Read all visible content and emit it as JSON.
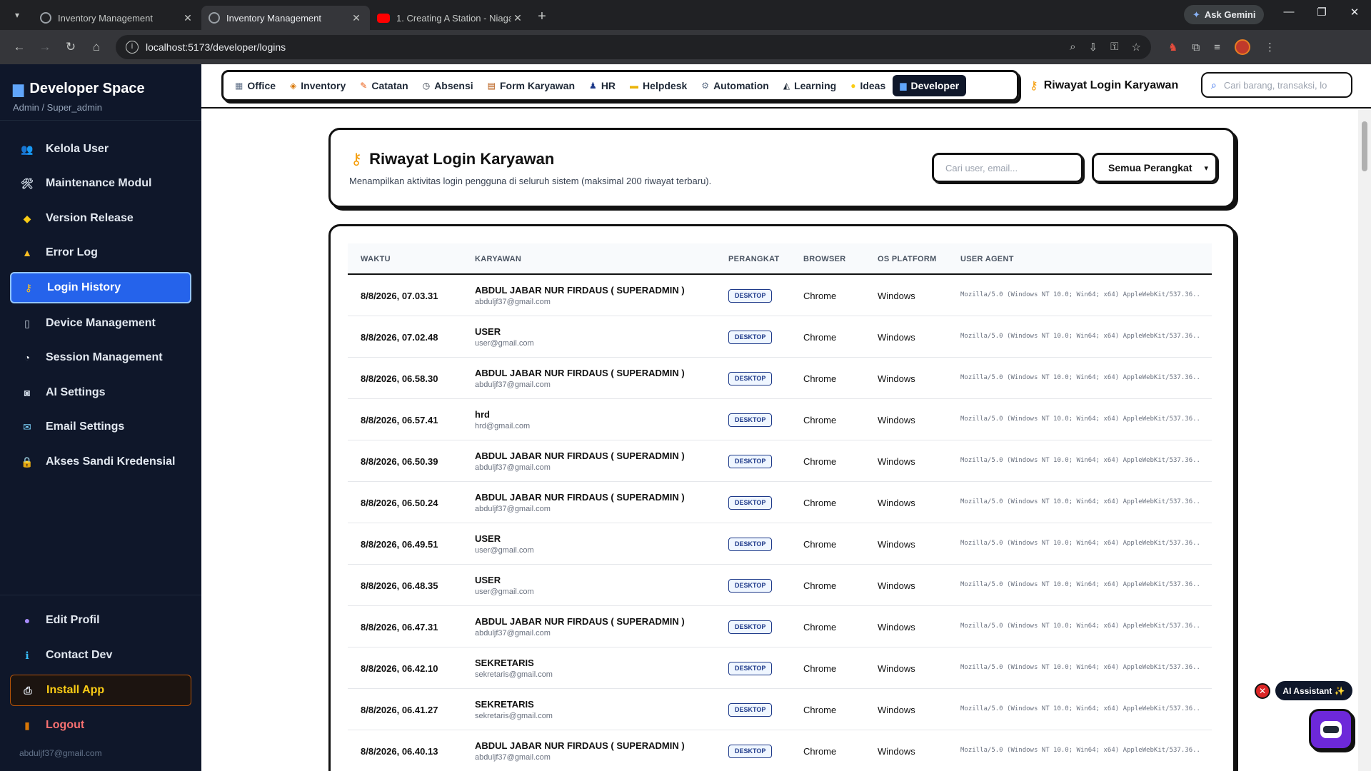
{
  "browser": {
    "tabs": [
      {
        "title": "Inventory Management",
        "active": false
      },
      {
        "title": "Inventory Management",
        "active": true
      },
      {
        "title": "1. Creating A Station - Niagara",
        "active": false
      }
    ],
    "ask_gemini": "Ask Gemini",
    "url": "localhost:5173/developer/logins"
  },
  "sidebar": {
    "brand_title": "Developer Space",
    "brand_sub": "Admin / Super_admin",
    "items": [
      {
        "label": "Kelola User",
        "icon": "users-icon"
      },
      {
        "label": "Maintenance Modul",
        "icon": "tools-icon"
      },
      {
        "label": "Version Release",
        "icon": "tag-icon"
      },
      {
        "label": "Error Log",
        "icon": "warning-icon"
      },
      {
        "label": "Login History",
        "icon": "key-icon",
        "active": true
      },
      {
        "label": "Device Management",
        "icon": "phone-icon"
      },
      {
        "label": "Session Management",
        "icon": "stopwatch-icon"
      },
      {
        "label": "AI Settings",
        "icon": "robot-icon"
      },
      {
        "label": "Email Settings",
        "icon": "email-icon"
      },
      {
        "label": "Akses Sandi Kredensial",
        "icon": "lock-icon"
      }
    ],
    "bottom": [
      {
        "label": "Edit Profil",
        "icon": "user-icon"
      },
      {
        "label": "Contact Dev",
        "icon": "info-icon"
      },
      {
        "label": "Install App",
        "icon": "install-icon"
      },
      {
        "label": "Logout",
        "icon": "door-icon"
      }
    ],
    "email": "abduljf37@gmail.com"
  },
  "topnav": {
    "modules": [
      {
        "label": "Office",
        "icon": "office-icon"
      },
      {
        "label": "Inventory",
        "icon": "box-icon"
      },
      {
        "label": "Catatan",
        "icon": "note-icon"
      },
      {
        "label": "Absensi",
        "icon": "clock-icon"
      },
      {
        "label": "Form Karyawan",
        "icon": "clipboard-icon"
      },
      {
        "label": "HR",
        "icon": "person-icon"
      },
      {
        "label": "Helpdesk",
        "icon": "ticket-icon"
      },
      {
        "label": "Automation",
        "icon": "gear-icon"
      },
      {
        "label": "Learning",
        "icon": "graduation-icon"
      },
      {
        "label": "Ideas",
        "icon": "bulb-icon"
      },
      {
        "label": "Developer",
        "icon": "laptop-icon",
        "active": true
      }
    ],
    "crumb": "Riwayat Login Karyawan",
    "search_placeholder": "Cari barang, transaksi, lo"
  },
  "header": {
    "title": "Riwayat Login Karyawan",
    "subtitle": "Menampilkan aktivitas login pengguna di seluruh sistem (maksimal 200 riwayat terbaru).",
    "search_placeholder": "Cari user, email...",
    "device_filter": "Semua Perangkat"
  },
  "table": {
    "columns": [
      "WAKTU",
      "KARYAWAN",
      "PERANGKAT",
      "BROWSER",
      "OS PLATFORM",
      "USER AGENT"
    ],
    "rows": [
      {
        "time": "8/8/2026, 07.03.31",
        "name": "ABDUL JABAR NUR FIRDAUS ( SUPERADMIN )",
        "email": "abduljf37@gmail.com",
        "device": "DESKTOP",
        "browser": "Chrome",
        "os": "Windows",
        "ua": "Mozilla/5.0 (Windows NT 10.0; Win64; x64) AppleWebKit/537.36..."
      },
      {
        "time": "8/8/2026, 07.02.48",
        "name": "USER",
        "email": "user@gmail.com",
        "device": "DESKTOP",
        "browser": "Chrome",
        "os": "Windows",
        "ua": "Mozilla/5.0 (Windows NT 10.0; Win64; x64) AppleWebKit/537.36..."
      },
      {
        "time": "8/8/2026, 06.58.30",
        "name": "ABDUL JABAR NUR FIRDAUS ( SUPERADMIN )",
        "email": "abduljf37@gmail.com",
        "device": "DESKTOP",
        "browser": "Chrome",
        "os": "Windows",
        "ua": "Mozilla/5.0 (Windows NT 10.0; Win64; x64) AppleWebKit/537.36..."
      },
      {
        "time": "8/8/2026, 06.57.41",
        "name": "hrd",
        "email": "hrd@gmail.com",
        "device": "DESKTOP",
        "browser": "Chrome",
        "os": "Windows",
        "ua": "Mozilla/5.0 (Windows NT 10.0; Win64; x64) AppleWebKit/537.36..."
      },
      {
        "time": "8/8/2026, 06.50.39",
        "name": "ABDUL JABAR NUR FIRDAUS ( SUPERADMIN )",
        "email": "abduljf37@gmail.com",
        "device": "DESKTOP",
        "browser": "Chrome",
        "os": "Windows",
        "ua": "Mozilla/5.0 (Windows NT 10.0; Win64; x64) AppleWebKit/537.36..."
      },
      {
        "time": "8/8/2026, 06.50.24",
        "name": "ABDUL JABAR NUR FIRDAUS ( SUPERADMIN )",
        "email": "abduljf37@gmail.com",
        "device": "DESKTOP",
        "browser": "Chrome",
        "os": "Windows",
        "ua": "Mozilla/5.0 (Windows NT 10.0; Win64; x64) AppleWebKit/537.36..."
      },
      {
        "time": "8/8/2026, 06.49.51",
        "name": "USER",
        "email": "user@gmail.com",
        "device": "DESKTOP",
        "browser": "Chrome",
        "os": "Windows",
        "ua": "Mozilla/5.0 (Windows NT 10.0; Win64; x64) AppleWebKit/537.36..."
      },
      {
        "time": "8/8/2026, 06.48.35",
        "name": "USER",
        "email": "user@gmail.com",
        "device": "DESKTOP",
        "browser": "Chrome",
        "os": "Windows",
        "ua": "Mozilla/5.0 (Windows NT 10.0; Win64; x64) AppleWebKit/537.36..."
      },
      {
        "time": "8/8/2026, 06.47.31",
        "name": "ABDUL JABAR NUR FIRDAUS ( SUPERADMIN )",
        "email": "abduljf37@gmail.com",
        "device": "DESKTOP",
        "browser": "Chrome",
        "os": "Windows",
        "ua": "Mozilla/5.0 (Windows NT 10.0; Win64; x64) AppleWebKit/537.36..."
      },
      {
        "time": "8/8/2026, 06.42.10",
        "name": "SEKRETARIS",
        "email": "sekretaris@gmail.com",
        "device": "DESKTOP",
        "browser": "Chrome",
        "os": "Windows",
        "ua": "Mozilla/5.0 (Windows NT 10.0; Win64; x64) AppleWebKit/537.36..."
      },
      {
        "time": "8/8/2026, 06.41.27",
        "name": "SEKRETARIS",
        "email": "sekretaris@gmail.com",
        "device": "DESKTOP",
        "browser": "Chrome",
        "os": "Windows",
        "ua": "Mozilla/5.0 (Windows NT 10.0; Win64; x64) AppleWebKit/537.36..."
      },
      {
        "time": "8/8/2026, 06.40.13",
        "name": "ABDUL JABAR NUR FIRDAUS ( SUPERADMIN )",
        "email": "abduljf37@gmail.com",
        "device": "DESKTOP",
        "browser": "Chrome",
        "os": "Windows",
        "ua": "Mozilla/5.0 (Windows NT 10.0; Win64; x64) AppleWebKit/537.36..."
      }
    ]
  },
  "assistant": {
    "label": "AI Assistant ✨"
  }
}
